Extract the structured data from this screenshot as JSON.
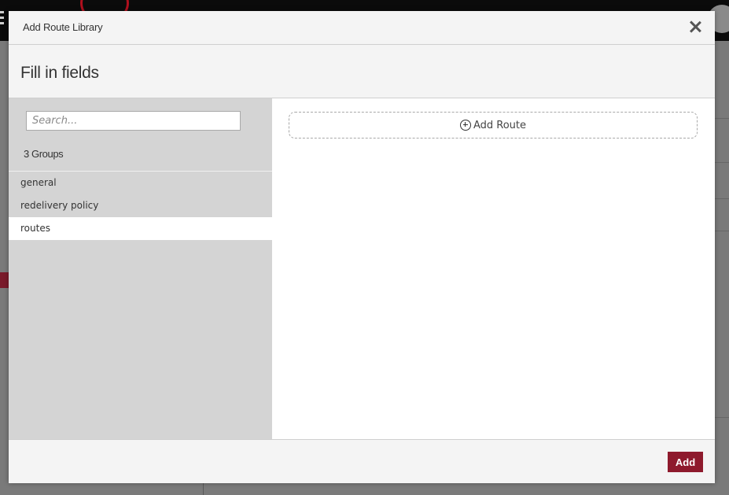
{
  "modal": {
    "title": "Add Route Library",
    "subtitle": "Fill in fields",
    "search": {
      "placeholder": "Search...",
      "value": ""
    },
    "groups_count": "3 Groups",
    "groups": [
      {
        "label": "general",
        "active": false
      },
      {
        "label": "redelivery policy",
        "active": false
      },
      {
        "label": "routes",
        "active": true
      }
    ],
    "add_route_label": "Add Route",
    "add_button_label": "Add"
  },
  "icons": {
    "close": "close-icon",
    "add_route": "plus-circle-icon"
  },
  "colors": {
    "accent": "#8e1a2d",
    "left_panel": "#d4d4d4",
    "active_item": "#ffffff"
  }
}
